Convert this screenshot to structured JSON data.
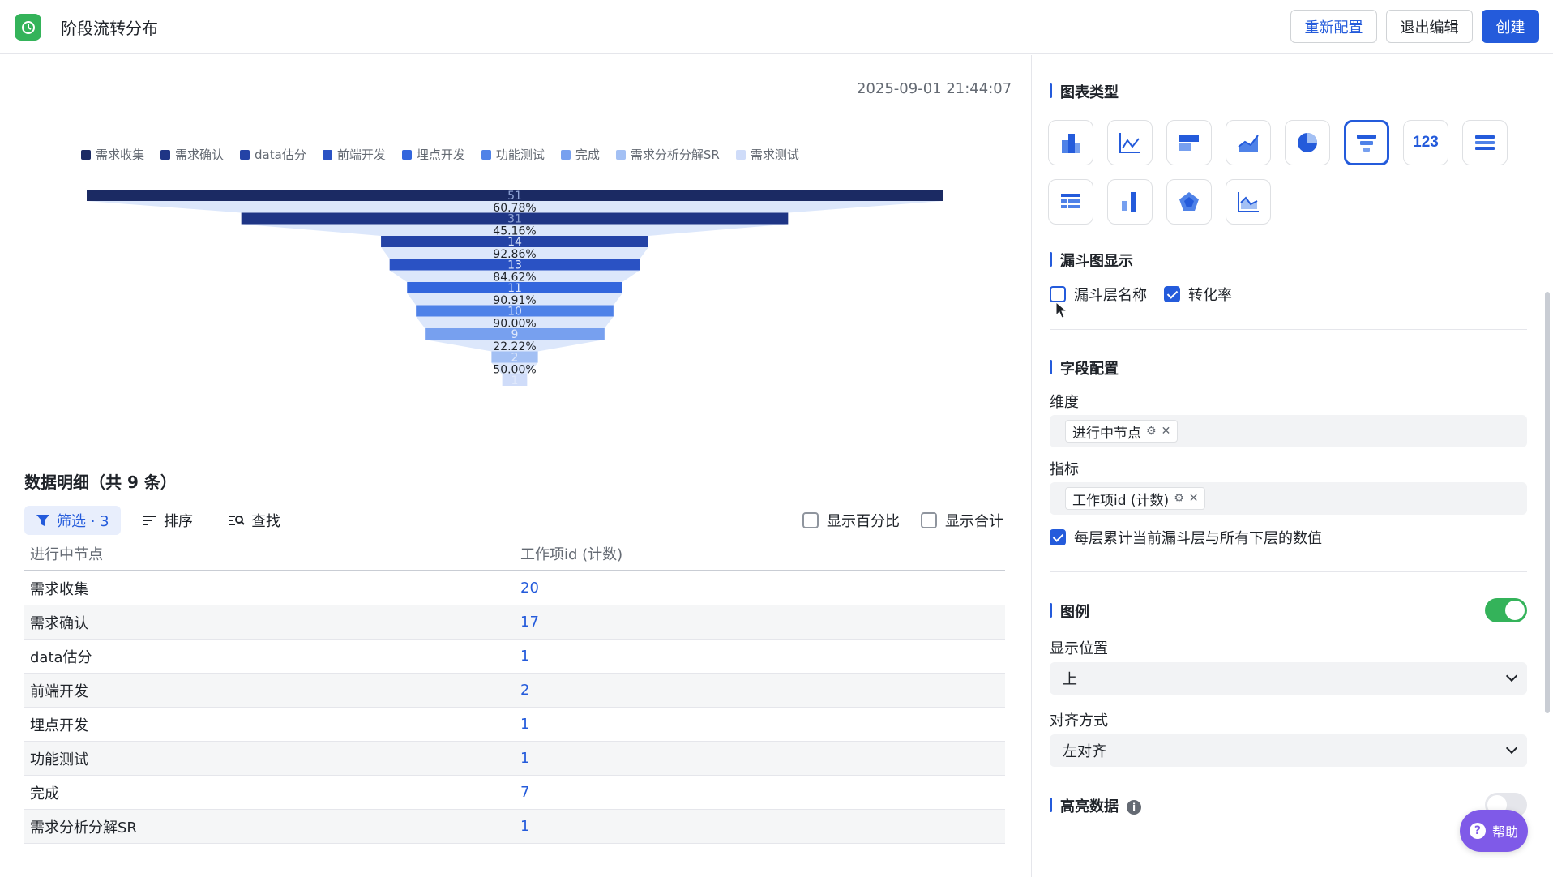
{
  "header": {
    "title": "阶段流转分布",
    "reconfigure_label": "重新配置",
    "exit_edit_label": "退出编辑",
    "create_label": "创建"
  },
  "chart": {
    "timestamp": "2025-09-01 21:44:07"
  },
  "chart_data": {
    "type": "funnel",
    "legend_position": "top-left",
    "stages": [
      {
        "name": "需求收集",
        "value": 51,
        "color": "#1b2a63"
      },
      {
        "name": "需求确认",
        "value": 31,
        "color": "#1f3585"
      },
      {
        "name": "data估分",
        "value": 14,
        "color": "#2443a6"
      },
      {
        "name": "前端开发",
        "value": 13,
        "color": "#2a52c4"
      },
      {
        "name": "埋点开发",
        "value": 11,
        "color": "#3366dd"
      },
      {
        "name": "功能测试",
        "value": 10,
        "color": "#4f82e8"
      },
      {
        "name": "完成",
        "value": 9,
        "color": "#77a0ef"
      },
      {
        "name": "需求分析分解SR",
        "value": 2,
        "color": "#a3c0f4"
      },
      {
        "name": "需求测试",
        "value": 1,
        "color": "#cfdcf9"
      }
    ],
    "conversion_rates": [
      "60.78%",
      "45.16%",
      "92.86%",
      "84.62%",
      "90.91%",
      "90.00%",
      "22.22%",
      "50.00%"
    ]
  },
  "detail": {
    "title": "数据明细（共 9 条）",
    "filter_label": "筛选 · 3",
    "sort_label": "排序",
    "search_label": "查找",
    "show_percent_label": "显示百分比",
    "show_total_label": "显示合计",
    "columns": [
      "进行中节点",
      "工作项id (计数)"
    ],
    "rows": [
      [
        "需求收集",
        "20"
      ],
      [
        "需求确认",
        "17"
      ],
      [
        "data估分",
        "1"
      ],
      [
        "前端开发",
        "2"
      ],
      [
        "埋点开发",
        "1"
      ],
      [
        "功能测试",
        "1"
      ],
      [
        "完成",
        "7"
      ],
      [
        "需求分析分解SR",
        "1"
      ]
    ]
  },
  "config": {
    "chart_type_title": "图表类型",
    "number_card_glyph": "123",
    "funnel_display_title": "漏斗图显示",
    "layer_name_label": "漏斗层名称",
    "layer_name_checked": false,
    "conversion_label": "转化率",
    "conversion_checked": true,
    "field_config_title": "字段配置",
    "dimension_label": "维度",
    "dimension_tag": "进行中节点",
    "metric_label": "指标",
    "metric_tag": "工作项id (计数)",
    "cumulative_label": "每层累计当前漏斗层与所有下层的数值",
    "cumulative_checked": true,
    "legend_title": "图例",
    "legend_on": true,
    "position_label": "显示位置",
    "position_value": "上",
    "align_label": "对齐方式",
    "align_value": "左对齐",
    "highlight_title": "高亮数据",
    "highlight_on": false
  },
  "help": {
    "label": "帮助"
  },
  "colors": {
    "accent": "#245bdb",
    "toggle_on": "#34b35a",
    "help": "#7f5ae8"
  }
}
